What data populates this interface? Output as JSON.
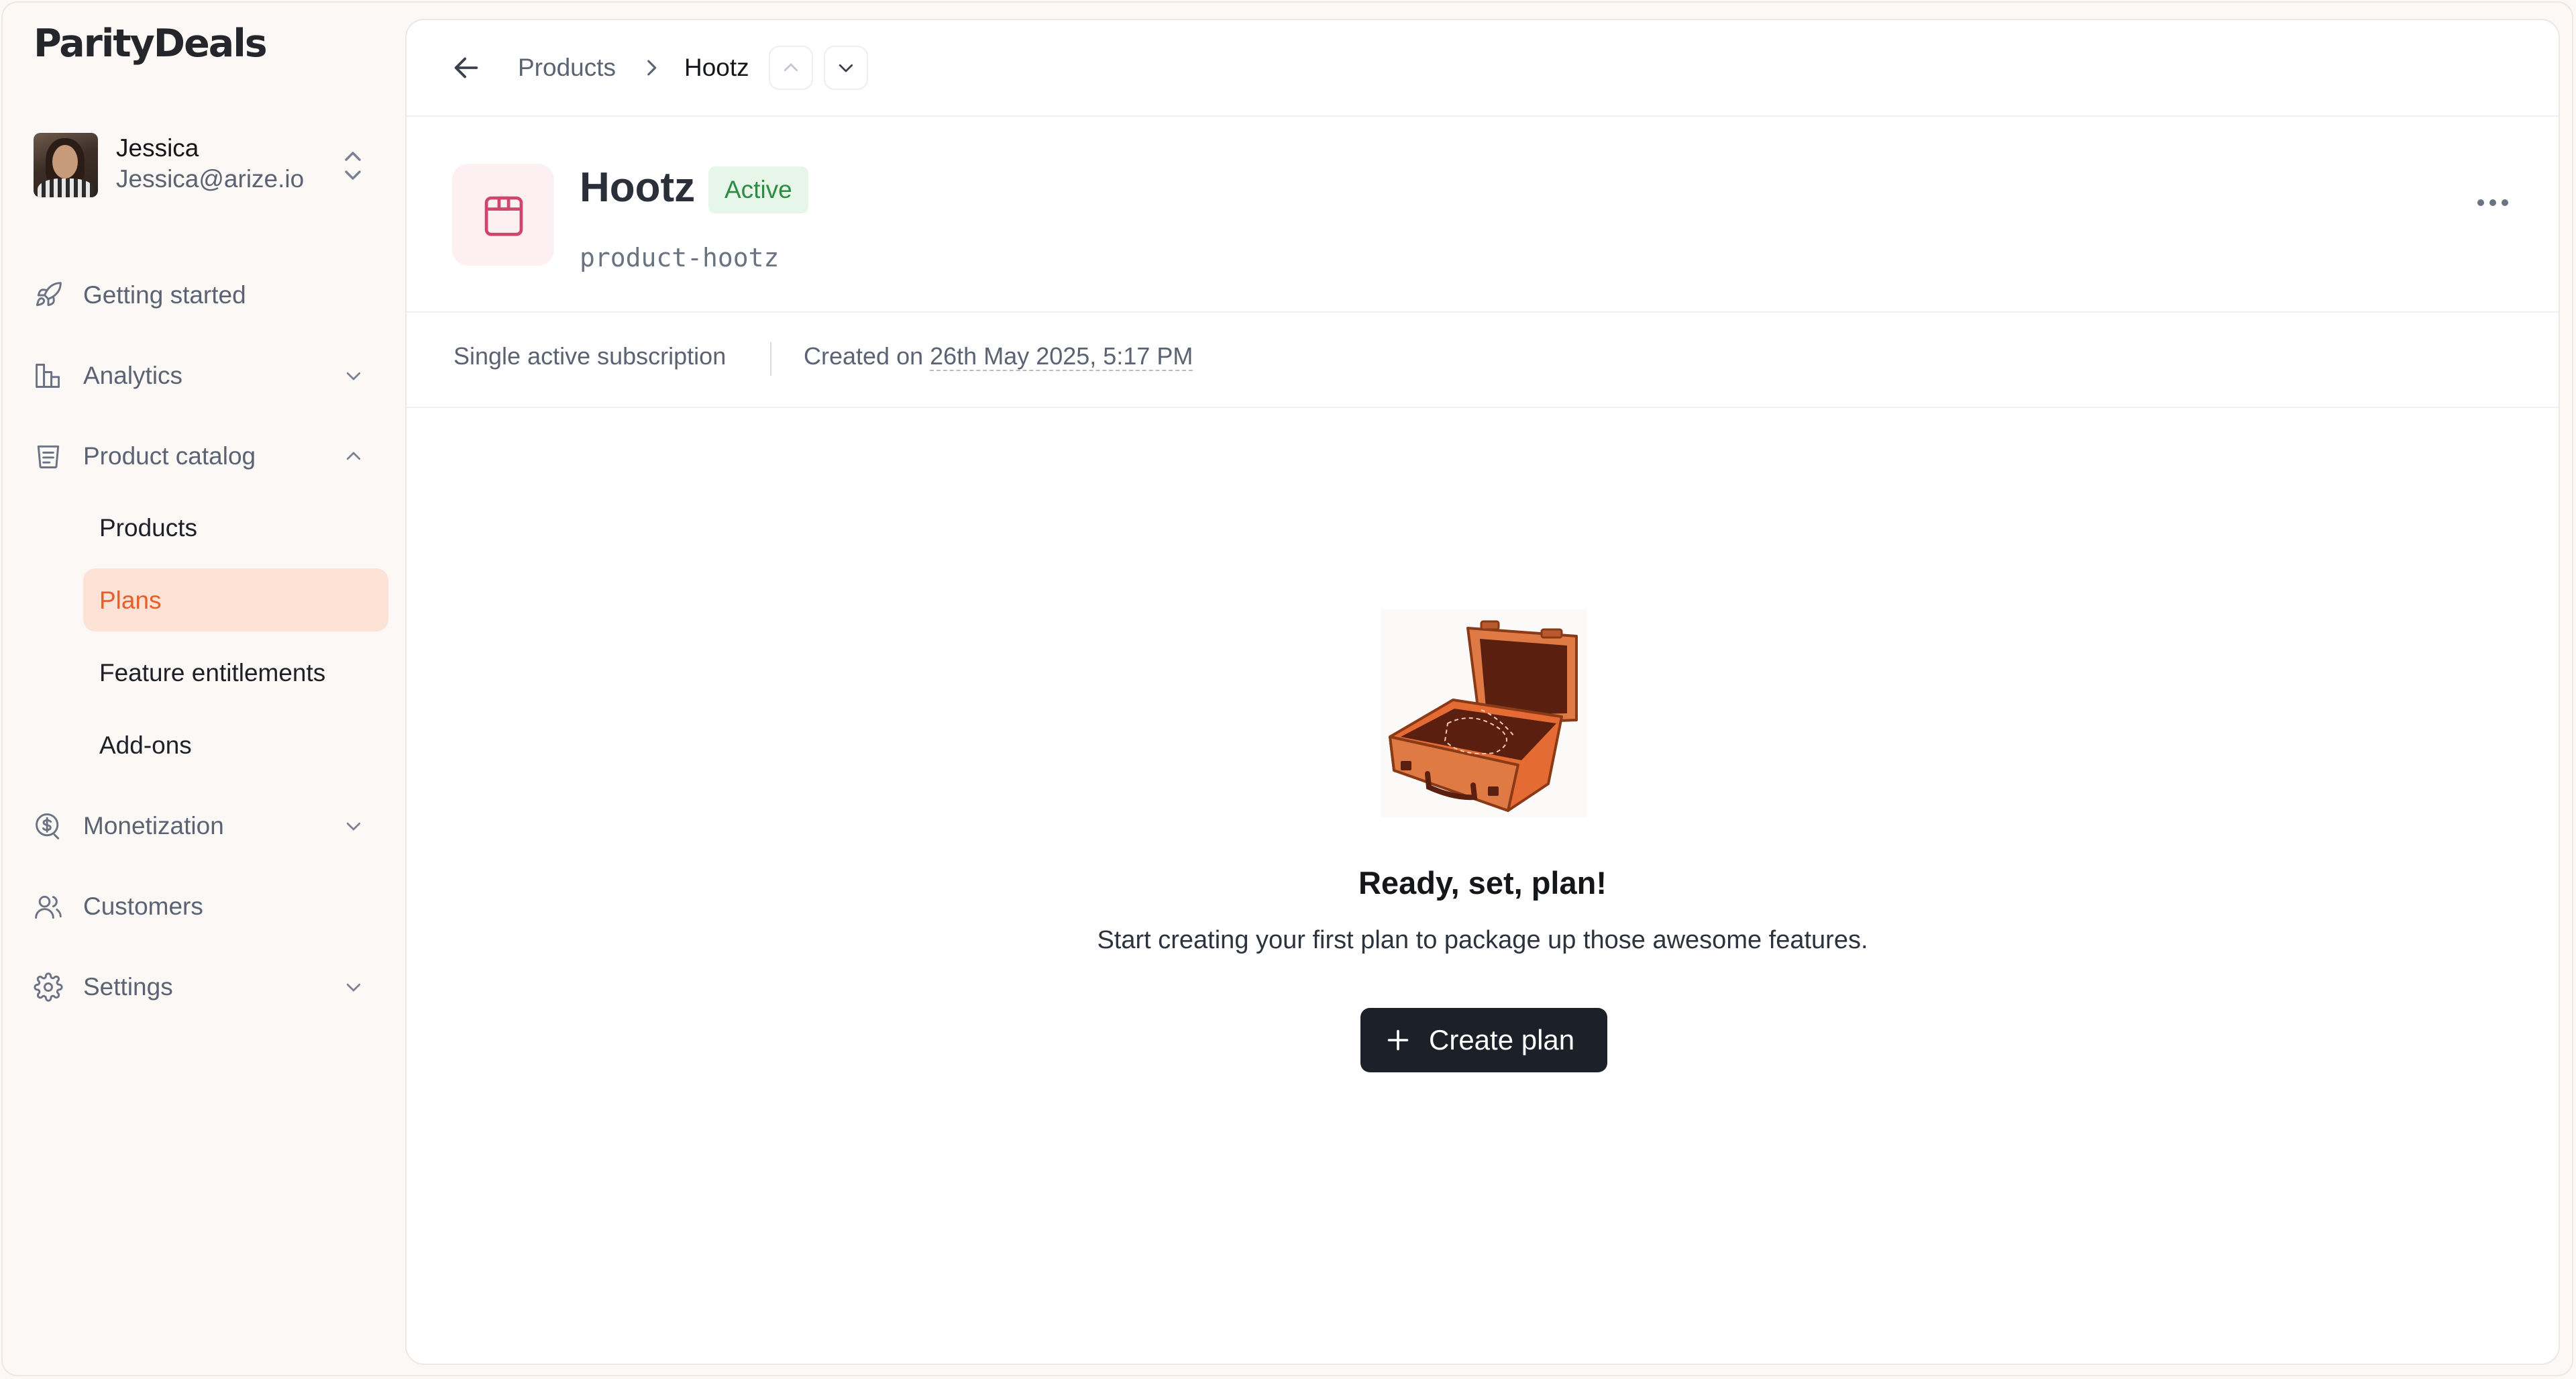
{
  "app": {
    "logo": "ParityDeals"
  },
  "user": {
    "name": "Jessica",
    "email": "Jessica@arize.io"
  },
  "sidebar": {
    "items": [
      {
        "label": "Getting started",
        "icon": "rocket-icon"
      },
      {
        "label": "Analytics",
        "icon": "bar-chart-icon"
      },
      {
        "label": "Product catalog",
        "icon": "catalog-icon",
        "expanded": true
      },
      {
        "label": "Monetization",
        "icon": "dollar-circle-icon"
      },
      {
        "label": "Customers",
        "icon": "users-icon"
      },
      {
        "label": "Settings",
        "icon": "gear-icon"
      }
    ],
    "sub_items": [
      {
        "label": "Products"
      },
      {
        "label": "Plans",
        "active": true
      },
      {
        "label": "Feature entitlements"
      },
      {
        "label": "Add-ons"
      }
    ]
  },
  "breadcrumb": {
    "parent": "Products",
    "current": "Hootz"
  },
  "product": {
    "name": "Hootz",
    "status": "Active",
    "slug": "product-hootz"
  },
  "meta": {
    "subscription": "Single active subscription",
    "created_prefix": "Created on",
    "created_date": "26th May 2025, 5:17 PM"
  },
  "empty_state": {
    "title": "Ready, set, plan!",
    "description": "Start creating your first plan to package up those awesome features.",
    "button": "Create plan"
  },
  "colors": {
    "accent": "#e85d2c",
    "active_bg": "#fde2d6",
    "badge_bg": "#e6f7e9",
    "badge_text": "#2f8a44",
    "button_bg": "#1c2129"
  }
}
